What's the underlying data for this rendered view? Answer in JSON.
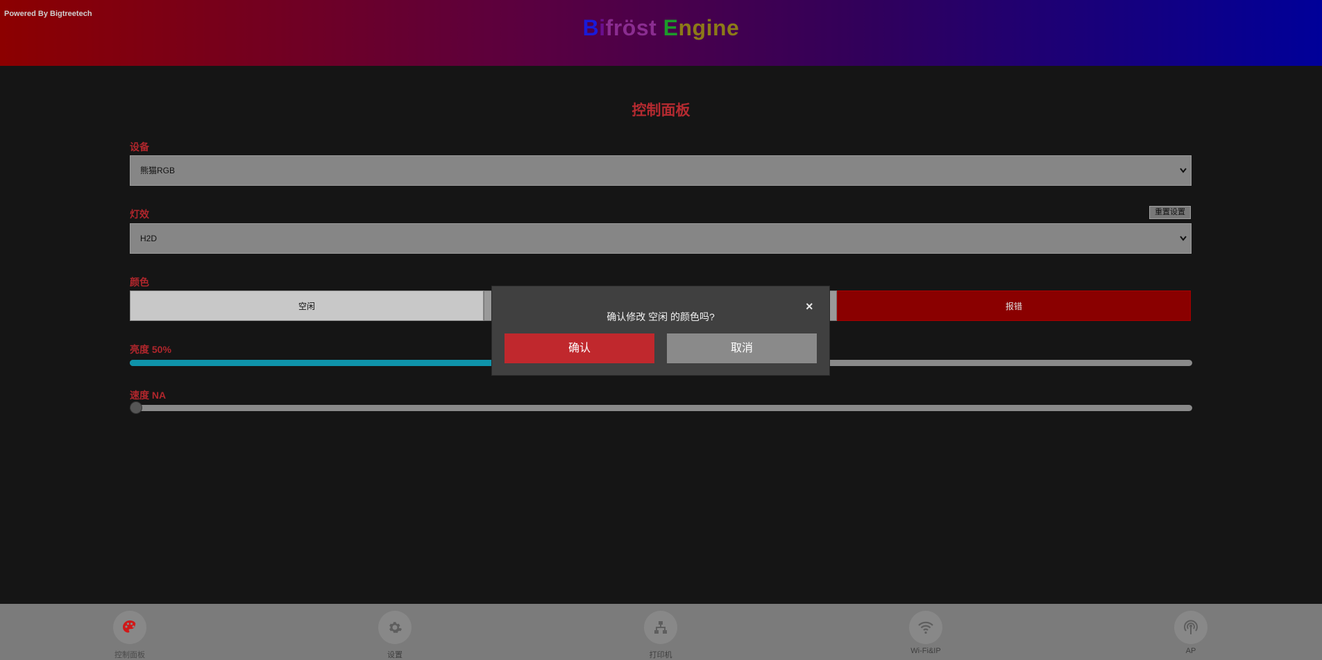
{
  "header": {
    "powered_by": "Powered By Bigtreetech",
    "brand_parts": [
      "B",
      "i",
      "fröst",
      " E",
      "ngine"
    ]
  },
  "page_title": "控制面板",
  "device": {
    "label": "设备",
    "value": "熊猫RGB"
  },
  "effect": {
    "label": "灯效",
    "value": "H2D",
    "reset_label": "重置设置"
  },
  "color": {
    "label": "颜色",
    "buttons": [
      "空闲",
      "",
      "报错"
    ]
  },
  "brightness": {
    "label": "亮度 50%",
    "value_percent": 50
  },
  "speed": {
    "label": "速度 NA",
    "value_percent": 0
  },
  "dialog": {
    "message": "确认修改 空闲 的颜色吗?",
    "close": "×",
    "confirm": "确认",
    "cancel": "取消"
  },
  "nav": {
    "items": [
      {
        "label": "控制面板",
        "icon": "palette-icon",
        "active": true
      },
      {
        "label": "设置",
        "icon": "gear-icon",
        "active": false
      },
      {
        "label": "打印机",
        "icon": "network-icon",
        "active": false
      },
      {
        "label": "Wi-Fi&IP",
        "icon": "wifi-icon",
        "active": false
      },
      {
        "label": "AP",
        "icon": "antenna-icon",
        "active": false
      }
    ]
  },
  "colors": {
    "accent_red": "#b0262c",
    "error_red": "#8a0000",
    "slider_cyan": "#0f93aa",
    "confirm_red": "#c0282d"
  }
}
